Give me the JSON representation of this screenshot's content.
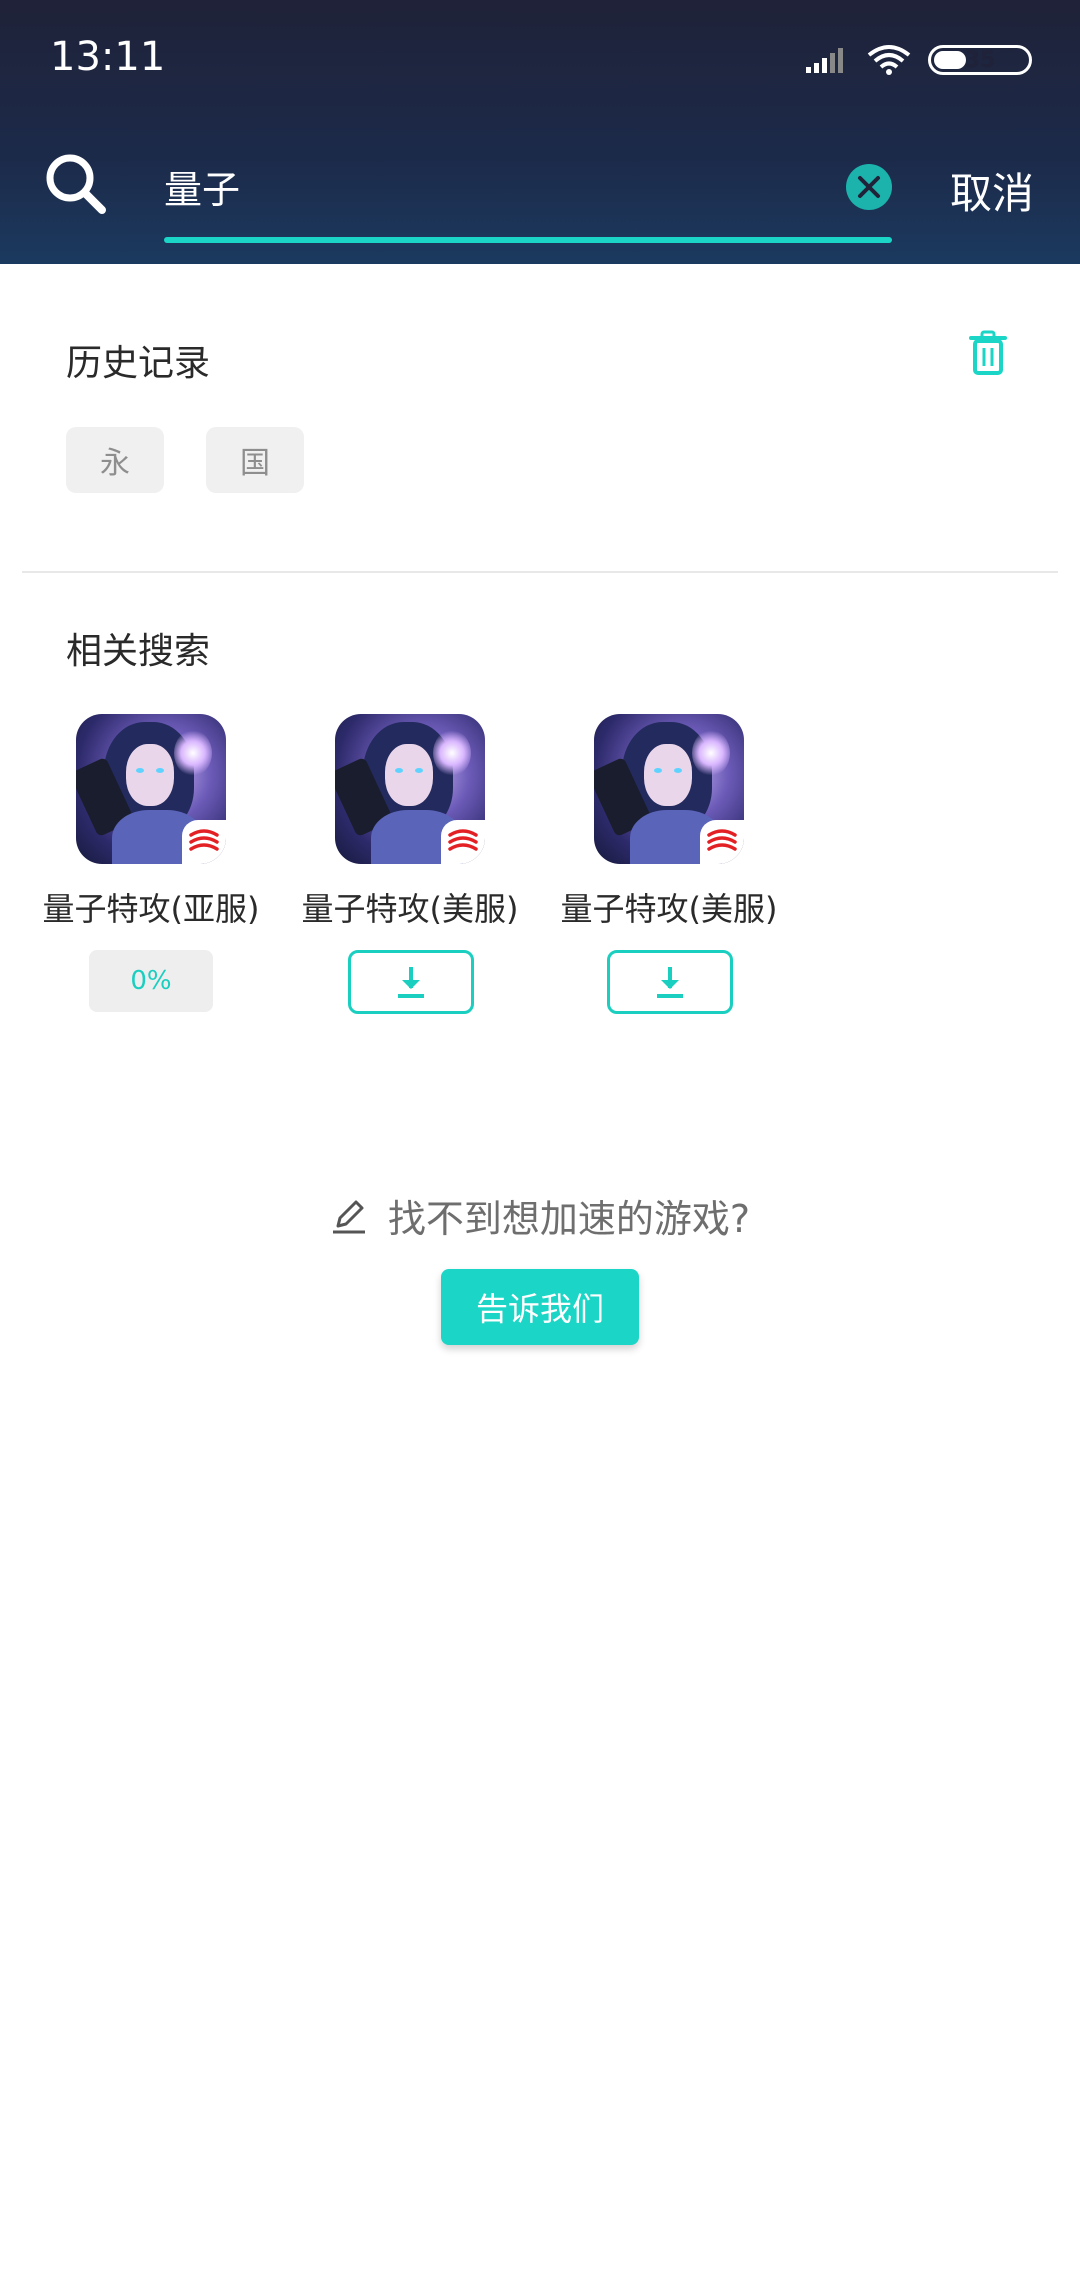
{
  "status_bar": {
    "time": "13:11",
    "battery": "35",
    "battery_level": 0.35
  },
  "search": {
    "query": "量子",
    "cancel_label": "取消"
  },
  "history": {
    "title": "历史记录",
    "chips": [
      "永",
      "国"
    ]
  },
  "related": {
    "title": "相关搜索",
    "games": [
      {
        "name": "量子特攻(亚服)",
        "action": "progress",
        "progress_label": "0%"
      },
      {
        "name": "量子特攻(美服)",
        "action": "download"
      },
      {
        "name": "量子特攻(美服)",
        "action": "download"
      }
    ]
  },
  "feedback": {
    "prompt": "找不到想加速的游戏?",
    "button_label": "告诉我们"
  },
  "colors": {
    "accent": "#1bd6c6",
    "header_top": "#1f2238",
    "header_bottom": "#1b3a5f"
  }
}
